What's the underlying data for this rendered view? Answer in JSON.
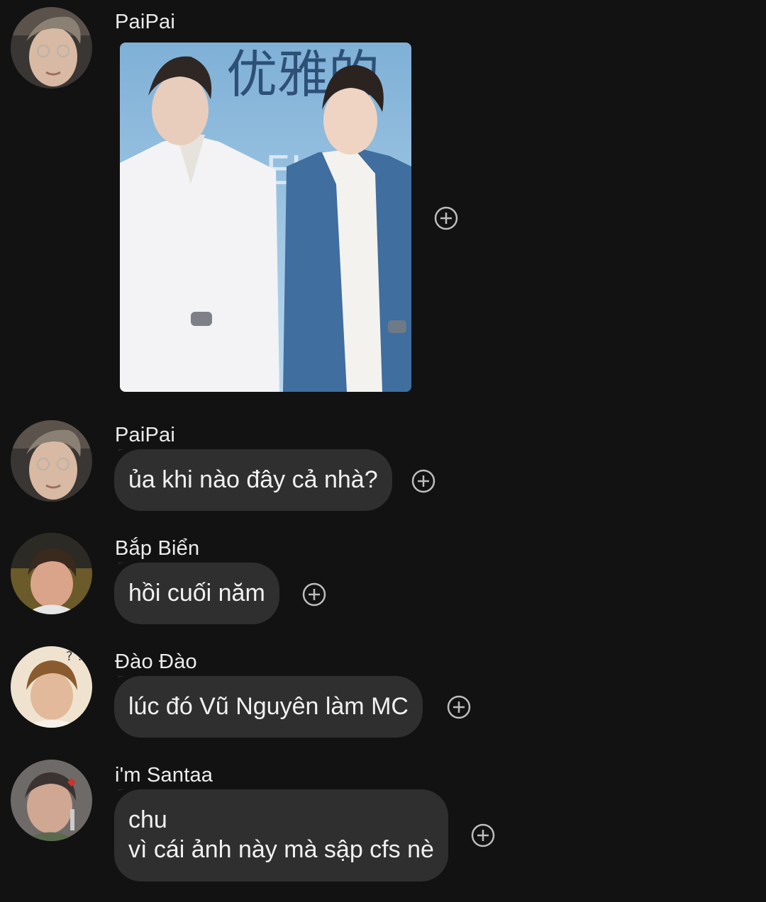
{
  "messages": [
    {
      "sender": "PaiPai",
      "avatar": "avatar-paipai",
      "kind": "image",
      "image": {
        "description": "photo-two-men-in-suits",
        "banner_text": "优雅的",
        "banner_text2": "ELE A"
      },
      "react_icon": "add-reaction-icon"
    },
    {
      "sender": "PaiPai",
      "avatar": "avatar-paipai",
      "kind": "text",
      "lines": [
        "ủa khi nào đây cả nhà?"
      ],
      "react_icon": "add-reaction-icon"
    },
    {
      "sender": "Bắp Biển",
      "avatar": "avatar-bap-bien",
      "kind": "text",
      "lines": [
        "hồi cuối năm"
      ],
      "react_icon": "add-reaction-icon"
    },
    {
      "sender": "Đào Đào",
      "avatar": "avatar-dao-dao",
      "kind": "text",
      "lines": [
        "lúc đó Vũ Nguyên làm MC"
      ],
      "react_icon": "add-reaction-icon"
    },
    {
      "sender": "i'm Santaa",
      "avatar": "avatar-im-santaa",
      "kind": "text",
      "lines": [
        "chu",
        "vì cái ảnh này mà sập cfs nè"
      ],
      "react_icon": "add-reaction-icon"
    }
  ],
  "colors": {
    "background": "#121212",
    "bubble": "#2f2f2f",
    "text": "#f1f1f1",
    "icon": "#bdbdbd"
  }
}
